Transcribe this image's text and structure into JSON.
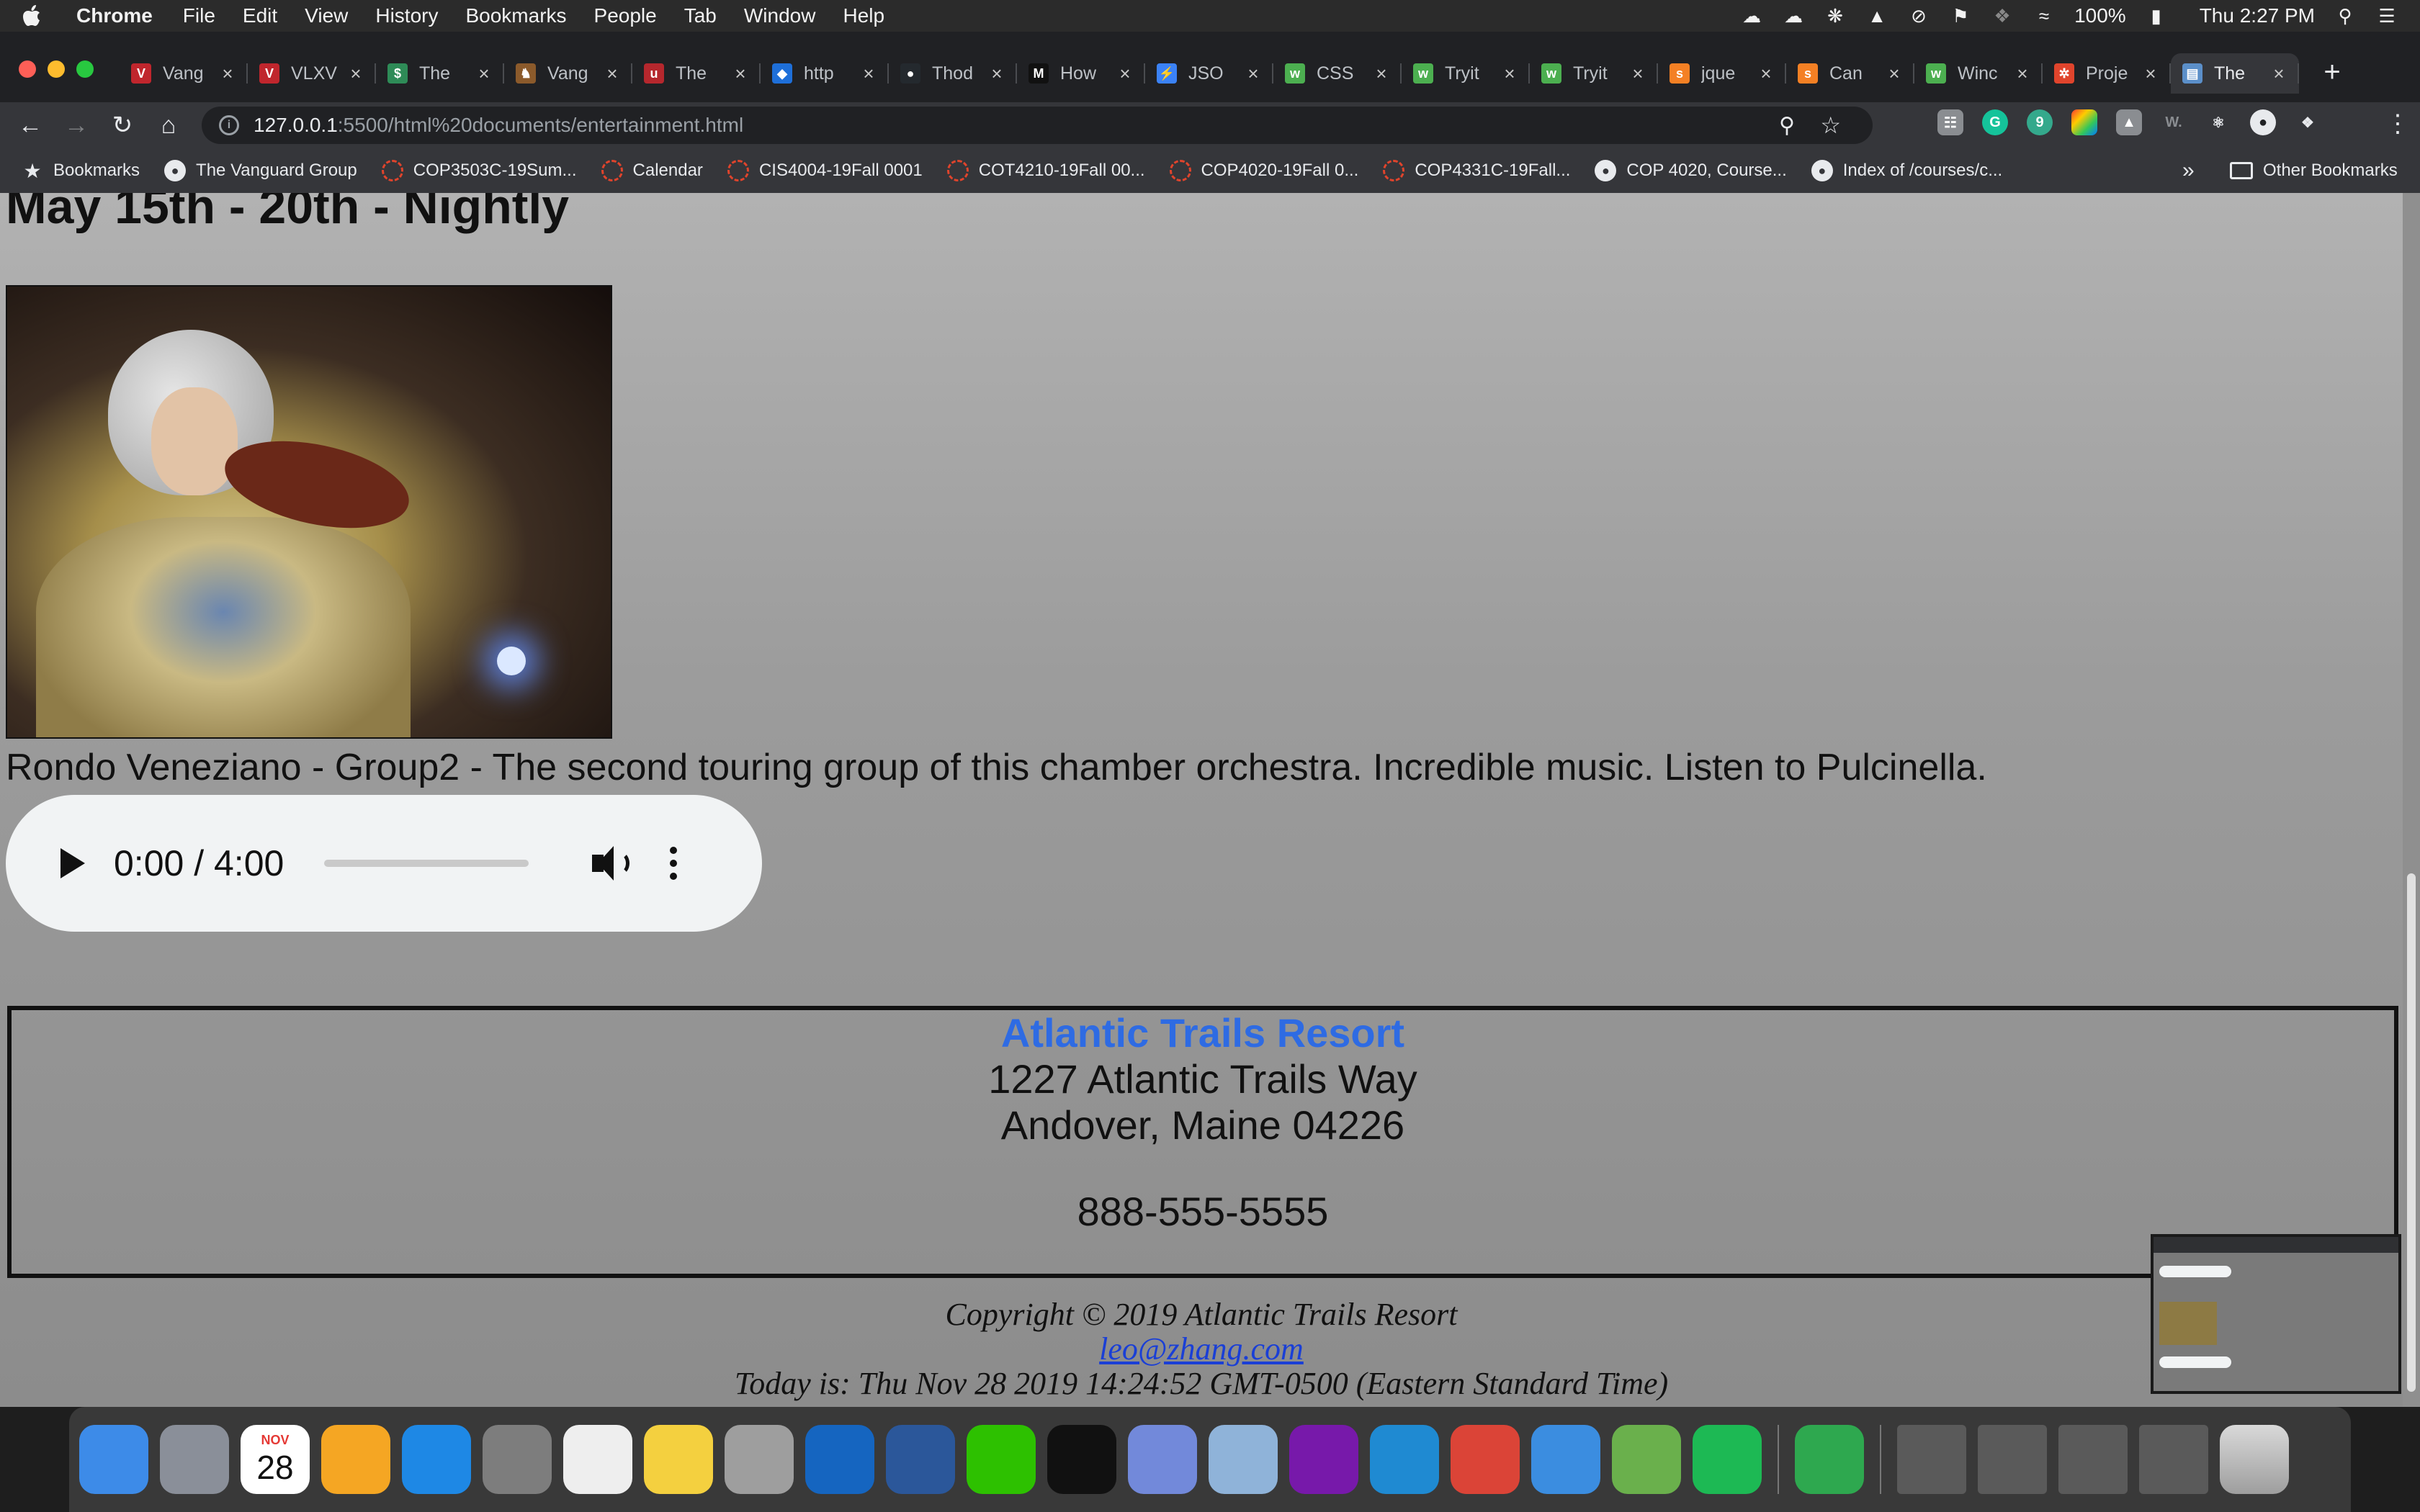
{
  "menubar": {
    "app_name": "Chrome",
    "menus": [
      "File",
      "Edit",
      "View",
      "History",
      "Bookmarks",
      "People",
      "Tab",
      "Window",
      "Help"
    ],
    "battery": "100%",
    "clock": "Thu 2:27 PM"
  },
  "tabs": [
    {
      "title": "Vang",
      "color": "#c0262d",
      "glyph": "V"
    },
    {
      "title": "VLXV",
      "color": "#c0262d",
      "glyph": "V"
    },
    {
      "title": "The",
      "color": "#2e8b57",
      "glyph": "$"
    },
    {
      "title": "Vang",
      "color": "#8b5a2b",
      "glyph": "♞"
    },
    {
      "title": "The",
      "color": "#b5272d",
      "glyph": "u"
    },
    {
      "title": "http",
      "color": "#1e6fd9",
      "glyph": "◆"
    },
    {
      "title": "Thod",
      "color": "#24292e",
      "glyph": "●"
    },
    {
      "title": "How",
      "color": "#111111",
      "glyph": "M"
    },
    {
      "title": "JSO",
      "color": "#3b82f6",
      "glyph": "⚡"
    },
    {
      "title": "CSS",
      "color": "#4caf50",
      "glyph": "w"
    },
    {
      "title": "Tryit",
      "color": "#4caf50",
      "glyph": "w"
    },
    {
      "title": "Tryit",
      "color": "#4caf50",
      "glyph": "w"
    },
    {
      "title": "jque",
      "color": "#f48024",
      "glyph": "s"
    },
    {
      "title": "Can",
      "color": "#f48024",
      "glyph": "s"
    },
    {
      "title": "Winc",
      "color": "#4caf50",
      "glyph": "w"
    },
    {
      "title": "Proje",
      "color": "#e0442c",
      "glyph": "✲"
    },
    {
      "title": "The",
      "color": "#5b8fc9",
      "glyph": "▤",
      "active": true
    }
  ],
  "omnibox": {
    "host": "127.0.0.1",
    "path": ":5500/html%20documents/entertainment.html"
  },
  "bookmarks": {
    "items": [
      {
        "label": "Bookmarks",
        "icon": "star-icon"
      },
      {
        "label": "The Vanguard Group",
        "icon": "globe-icon"
      },
      {
        "label": "COP3503C-19Sum...",
        "icon": "canvas-icon"
      },
      {
        "label": "Calendar",
        "icon": "canvas-icon"
      },
      {
        "label": "CIS4004-19Fall 0001",
        "icon": "canvas-icon"
      },
      {
        "label": "COT4210-19Fall 00...",
        "icon": "canvas-icon"
      },
      {
        "label": "COP4020-19Fall 0...",
        "icon": "canvas-icon"
      },
      {
        "label": "COP4331C-19Fall...",
        "icon": "canvas-icon"
      },
      {
        "label": "COP 4020, Course...",
        "icon": "globe-icon"
      },
      {
        "label": "Index of /courses/c...",
        "icon": "globe-icon"
      }
    ],
    "overflow": "»",
    "other": "Other Bookmarks"
  },
  "page": {
    "heading": "May 15th - 20th - Nightly",
    "description": "Rondo Veneziano - Group2 - The second touring group of this chamber orchestra. Incredible music. Listen to Pulcinella.",
    "audio": {
      "time": "0:00 / 4:00"
    },
    "contact": {
      "name": "Atlantic Trails Resort",
      "street": "1227 Atlantic Trails Way",
      "city": "Andover, Maine 04226",
      "phone": "888-555-5555"
    },
    "footer": {
      "copyright": "Copyright © 2019 Atlantic Trails Resort",
      "email": "leo@zhang.com",
      "date": "Today is: Thu Nov 28 2019 14:24:52 GMT-0500 (Eastern Standard Time)"
    }
  },
  "dock": {
    "calendar_month": "NOV",
    "calendar_day": "28",
    "apps": [
      {
        "name": "finder",
        "color": "#3d8be8"
      },
      {
        "name": "launchpad",
        "color": "#8a8f99"
      },
      {
        "name": "calendar",
        "color": "#ffffff"
      },
      {
        "name": "photos",
        "color": "#f5a623"
      },
      {
        "name": "app-store",
        "color": "#1e88e5"
      },
      {
        "name": "system-preferences",
        "color": "#7d7d7d"
      },
      {
        "name": "textedit",
        "color": "#eeeeee"
      },
      {
        "name": "stickies",
        "color": "#f4d03f"
      },
      {
        "name": "script-editor",
        "color": "#9e9e9e"
      },
      {
        "name": "quicktime",
        "color": "#1565c0"
      },
      {
        "name": "word",
        "color": "#2b579a"
      },
      {
        "name": "wechat",
        "color": "#2dc100"
      },
      {
        "name": "terminal",
        "color": "#111111"
      },
      {
        "name": "discord",
        "color": "#7289da"
      },
      {
        "name": "preview",
        "color": "#8fb3d9"
      },
      {
        "name": "onenote",
        "color": "#7719aa"
      },
      {
        "name": "vscode",
        "color": "#1f8ad2"
      },
      {
        "name": "chrome",
        "color": "#db4437"
      },
      {
        "name": "transmit",
        "color": "#3b8de0"
      },
      {
        "name": "android-studio",
        "color": "#6ab04c"
      },
      {
        "name": "spotify",
        "color": "#1db954"
      },
      {
        "name": "news",
        "color": "#2ea84f"
      }
    ]
  }
}
